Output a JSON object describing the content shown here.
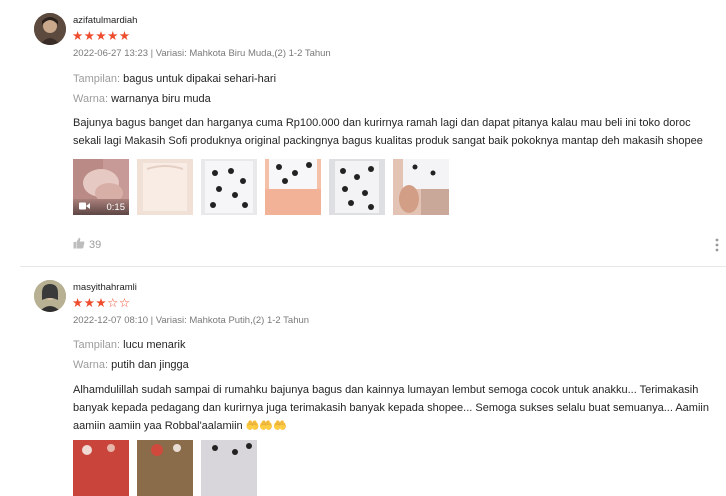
{
  "reviews": [
    {
      "username": "azifatulmardiah",
      "rating": 5,
      "stars": "★★★★★",
      "meta": "2022-06-27 13:23 | Variasi: Mahkota Biru Muda,(2) 1-2 Tahun",
      "attributes": [
        {
          "key": "Tampilan:",
          "value": "bagus untuk dipakai sehari-hari"
        },
        {
          "key": "Warna:",
          "value": "warnanya biru muda"
        }
      ],
      "comment": "Bajunya bagus banget dan harganya cuma Rp100.000 dan kurirnya ramah lagi dan dapat pitanya kalau mau beli ini toko doroc sekali lagi Makasih Sofi produknya original packingnya bagus kualitas produk sangat baik pokoknya mantap deh makasih shopee",
      "video_duration": "0:15",
      "likes": "39"
    },
    {
      "username": "masyithahramli",
      "rating": 3,
      "stars_on": "★★★",
      "stars_off": "☆☆",
      "meta": "2022-12-07 08:10 | Variasi: Mahkota Putih,(2) 1-2 Tahun",
      "attributes": [
        {
          "key": "Tampilan:",
          "value": "lucu menarik"
        },
        {
          "key": "Warna:",
          "value": "putih dan jingga"
        }
      ],
      "comment": "Alhamdulillah sudah sampai di rumahku bajunya bagus dan kainnya lumayan lembut semoga cocok untuk anakku... Terimakasih banyak kepada pedagang dan kurirnya juga terimakasih banyak kepada shopee... Semoga sukses selalu buat semuanya... Aamiin aamiin aamiin yaa Robbal'aalamiin 🤲🤲🤲"
    }
  ],
  "colors": {
    "star": "#ee4d2d",
    "divider": "#e8e8e8"
  }
}
